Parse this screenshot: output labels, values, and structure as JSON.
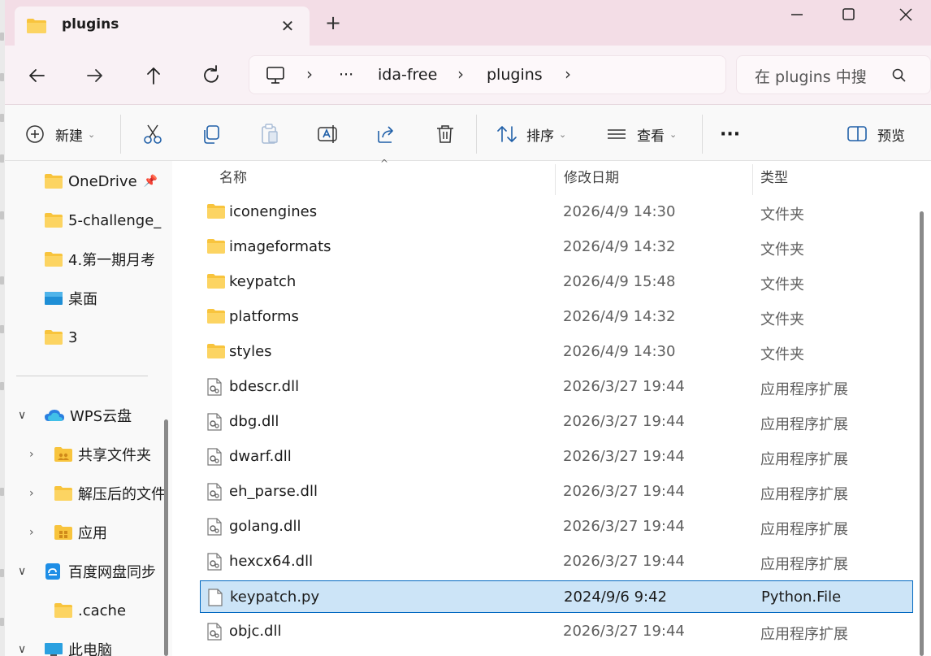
{
  "window": {
    "tab_title": "plugins",
    "new_tab_symbol": "+"
  },
  "address": {
    "overflow": "···",
    "crumbs": [
      "ida-free",
      "plugins"
    ]
  },
  "search": {
    "placeholder": "在 plugins 中搜"
  },
  "toolbar": {
    "new_label": "新建",
    "sort_label": "排序",
    "view_label": "查看",
    "more_label": "···",
    "preview_label": "预览"
  },
  "sidebar": {
    "items": [
      {
        "label": "OneDrive",
        "icon": "folder-icon"
      },
      {
        "label": "5-challenge_",
        "icon": "folder-icon"
      },
      {
        "label": "4.第一期月考",
        "icon": "folder-icon"
      },
      {
        "label": "桌面",
        "icon": "desktop-icon"
      },
      {
        "label": "3",
        "icon": "folder-icon"
      },
      {
        "label": "WPS云盘",
        "icon": "cloud-icon"
      },
      {
        "label": "共享文件夹",
        "icon": "shared-folder-icon"
      },
      {
        "label": "解压后的文件",
        "icon": "folder-icon"
      },
      {
        "label": "应用",
        "icon": "apps-folder-icon"
      },
      {
        "label": "百度网盘同步",
        "icon": "baidu-sync-icon"
      },
      {
        "label": ".cache",
        "icon": "folder-icon"
      },
      {
        "label": "此电脑",
        "icon": "pc-icon"
      }
    ]
  },
  "columns": {
    "name": "名称",
    "date": "修改日期",
    "type": "类型"
  },
  "files": [
    {
      "name": "iconengines",
      "date": "2026/4/9 14:30",
      "type": "文件夹",
      "kind": "folder"
    },
    {
      "name": "imageformats",
      "date": "2026/4/9 14:32",
      "type": "文件夹",
      "kind": "folder"
    },
    {
      "name": "keypatch",
      "date": "2026/4/9 15:48",
      "type": "文件夹",
      "kind": "folder"
    },
    {
      "name": "platforms",
      "date": "2026/4/9 14:32",
      "type": "文件夹",
      "kind": "folder"
    },
    {
      "name": "styles",
      "date": "2026/4/9 14:30",
      "type": "文件夹",
      "kind": "folder"
    },
    {
      "name": "bdescr.dll",
      "date": "2026/3/27 19:44",
      "type": "应用程序扩展",
      "kind": "dll"
    },
    {
      "name": "dbg.dll",
      "date": "2026/3/27 19:44",
      "type": "应用程序扩展",
      "kind": "dll"
    },
    {
      "name": "dwarf.dll",
      "date": "2026/3/27 19:44",
      "type": "应用程序扩展",
      "kind": "dll"
    },
    {
      "name": "eh_parse.dll",
      "date": "2026/3/27 19:44",
      "type": "应用程序扩展",
      "kind": "dll"
    },
    {
      "name": "golang.dll",
      "date": "2026/3/27 19:44",
      "type": "应用程序扩展",
      "kind": "dll"
    },
    {
      "name": "hexcx64.dll",
      "date": "2026/3/27 19:44",
      "type": "应用程序扩展",
      "kind": "dll"
    },
    {
      "name": "keypatch.py",
      "date": "2024/9/6 9:42",
      "type": "Python.File",
      "kind": "file",
      "selected": true
    },
    {
      "name": "objc.dll",
      "date": "2026/3/27 19:44",
      "type": "应用程序扩展",
      "kind": "dll"
    }
  ],
  "colors": {
    "tabbar_bg": "#f3dde6",
    "selection_bg": "#cce4f7",
    "selection_border": "#0067c0",
    "folder_yellow": "#f8c43d"
  }
}
